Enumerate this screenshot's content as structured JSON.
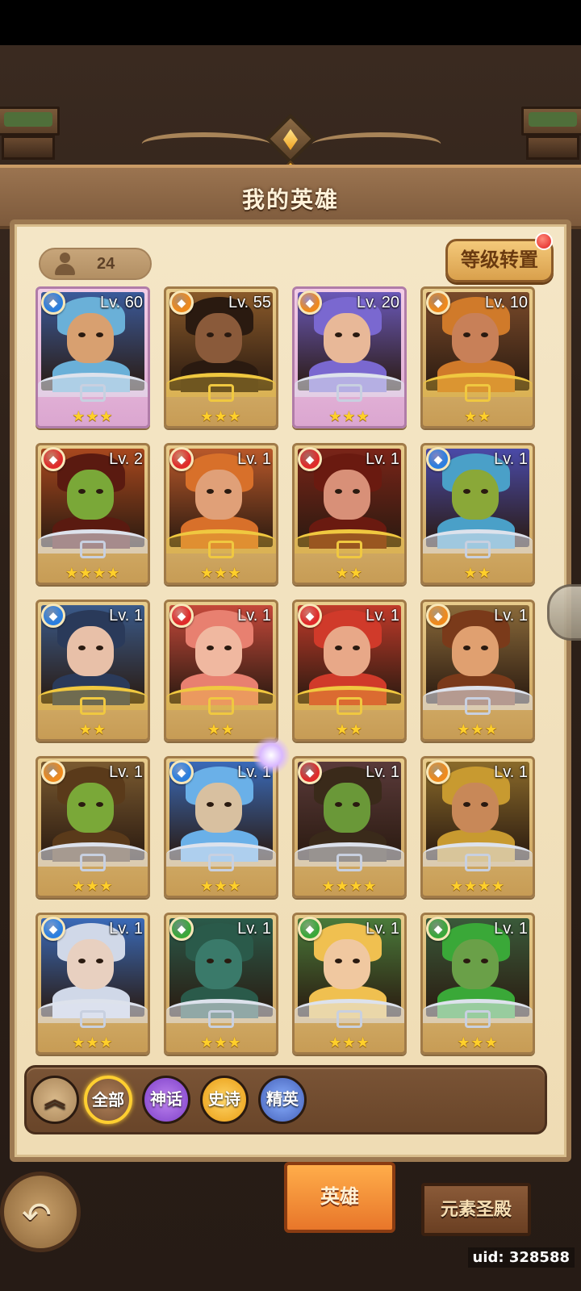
{
  "title": "我的英雄",
  "hero_count": "24",
  "level_transfer_label": "等级转置",
  "filters": {
    "collapse": "︽",
    "all": "全部",
    "myth": "神话",
    "epic": "史诗",
    "elite": "精英"
  },
  "tabs": {
    "hero": "英雄",
    "temple": "元素圣殿"
  },
  "uid": "uid: 328588",
  "heroes": [
    {
      "level": "Lv. 60",
      "stars": "★★★",
      "element": "water",
      "element_color": "#2a7fe0",
      "bg": "#3b5a9a"
    },
    {
      "level": "Lv. 55",
      "stars": "★★★",
      "element": "earth",
      "element_color": "#f08a1c",
      "bg": "#8a5a2a"
    },
    {
      "level": "Lv. 20",
      "stars": "★★★",
      "element": "earth",
      "element_color": "#f08a1c",
      "bg": "#6a58b8"
    },
    {
      "level": "Lv. 10",
      "stars": "★★",
      "element": "earth",
      "element_color": "#f08a1c",
      "bg": "#7a4a2a"
    },
    {
      "level": "Lv. 2",
      "stars": "★★★★",
      "element": "fire",
      "element_color": "#e02a2a",
      "bg": "#a8481e"
    },
    {
      "level": "Lv. 1",
      "stars": "★★★",
      "element": "fire",
      "element_color": "#e02a2a",
      "bg": "#b8582a"
    },
    {
      "level": "Lv. 1",
      "stars": "★★",
      "element": "fire",
      "element_color": "#e02a2a",
      "bg": "#7a2418"
    },
    {
      "level": "Lv. 1",
      "stars": "★★",
      "element": "water",
      "element_color": "#2a7fe0",
      "bg": "#4a4aa8"
    },
    {
      "level": "Lv. 1",
      "stars": "★★",
      "element": "water",
      "element_color": "#2a7fe0",
      "bg": "#3a5a8a"
    },
    {
      "level": "Lv. 1",
      "stars": "★★",
      "element": "fire",
      "element_color": "#e02a2a",
      "bg": "#c4483a"
    },
    {
      "level": "Lv. 1",
      "stars": "★★",
      "element": "fire",
      "element_color": "#e02a2a",
      "bg": "#c03a2a"
    },
    {
      "level": "Lv. 1",
      "stars": "★★★",
      "element": "earth",
      "element_color": "#f08a1c",
      "bg": "#8a6a3a"
    },
    {
      "level": "Lv. 1",
      "stars": "★★★",
      "element": "earth",
      "element_color": "#f08a1c",
      "bg": "#7a5a30"
    },
    {
      "level": "Lv. 1",
      "stars": "★★★",
      "element": "water",
      "element_color": "#2a7fe0",
      "bg": "#3a6ab8"
    },
    {
      "level": "Lv. 1",
      "stars": "★★★★",
      "element": "fire",
      "element_color": "#e02a2a",
      "bg": "#5a3a3a"
    },
    {
      "level": "Lv. 1",
      "stars": "★★★★",
      "element": "earth",
      "element_color": "#f08a1c",
      "bg": "#8a6a2a"
    },
    {
      "level": "Lv. 1",
      "stars": "★★★",
      "element": "water",
      "element_color": "#2a7fe0",
      "bg": "#3a6ab8"
    },
    {
      "level": "Lv. 1",
      "stars": "★★★",
      "element": "nature",
      "element_color": "#3aa83a",
      "bg": "#2a5a4a"
    },
    {
      "level": "Lv. 1",
      "stars": "★★★",
      "element": "nature",
      "element_color": "#3aa83a",
      "bg": "#4a7a3a"
    },
    {
      "level": "Lv. 1",
      "stars": "★★★",
      "element": "nature",
      "element_color": "#3aa83a",
      "bg": "#3a5a3a"
    }
  ]
}
